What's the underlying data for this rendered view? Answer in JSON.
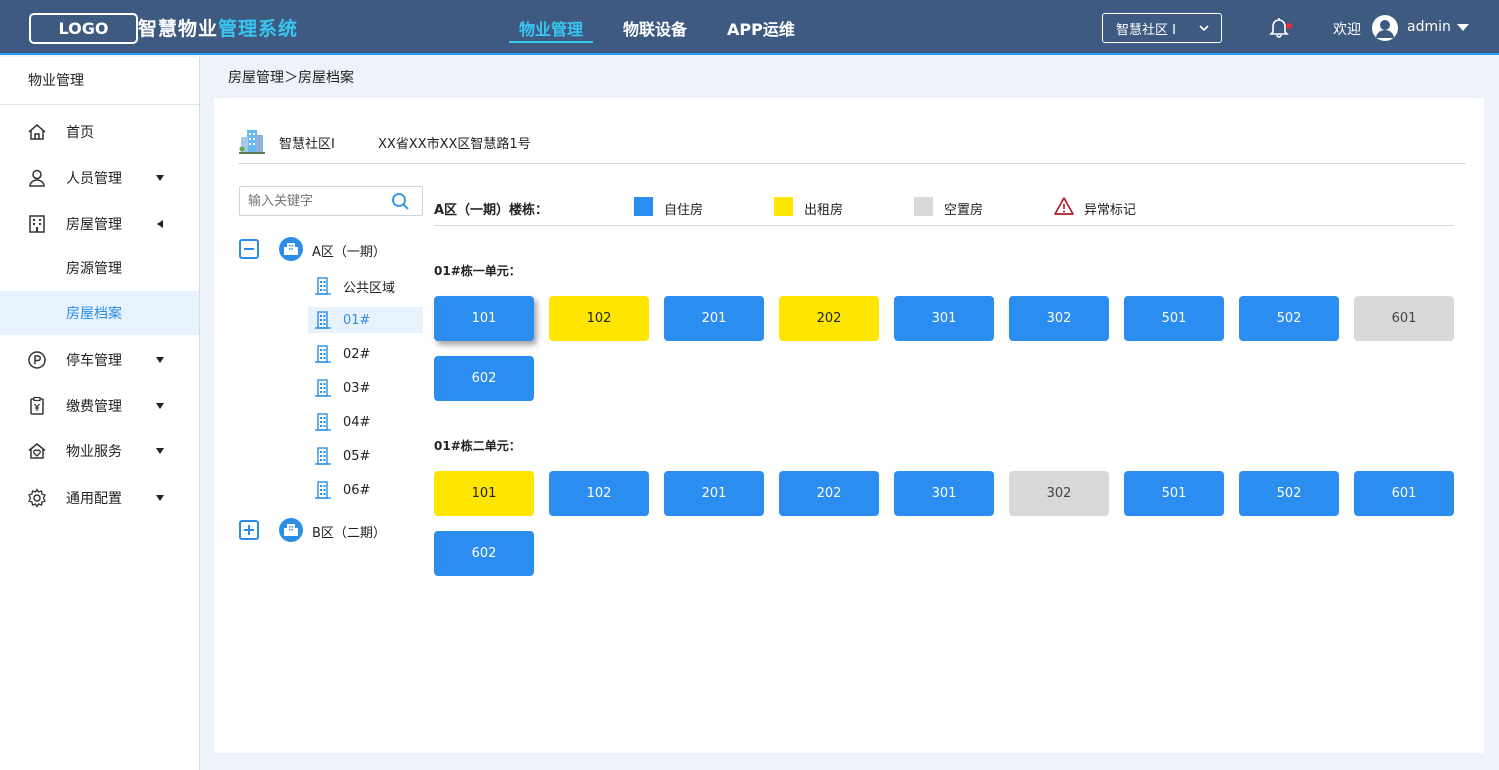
{
  "header": {
    "logo": "LOGO",
    "title_part1": "智慧物业",
    "title_part2": "管理系统",
    "nav": [
      "物业管理",
      "物联设备",
      "APP运维"
    ],
    "community_select": "智慧社区 I",
    "welcome": "欢迎",
    "username": "admin"
  },
  "sidebar": {
    "heading": "物业管理",
    "items": [
      {
        "label": "首页",
        "icon": "home-icon"
      },
      {
        "label": "人员管理",
        "icon": "user-icon"
      },
      {
        "label": "房屋管理",
        "icon": "building-icon"
      },
      {
        "label": "房源管理",
        "icon": ""
      },
      {
        "label": "房屋档案",
        "icon": ""
      },
      {
        "label": "停车管理",
        "icon": "parking-icon"
      },
      {
        "label": "缴费管理",
        "icon": "payment-icon"
      },
      {
        "label": "物业服务",
        "icon": "service-icon"
      },
      {
        "label": "通用配置",
        "icon": "gear-icon"
      }
    ]
  },
  "breadcrumb": "房屋管理＞房屋档案",
  "community": {
    "name": "智慧社区I",
    "address": "XX省XX市XX区智慧路1号"
  },
  "search": {
    "placeholder": "输入关键字"
  },
  "tree": {
    "zone_a": "A区（一期）",
    "zone_b": "B区（二期）",
    "children": [
      "公共区域",
      "01#",
      "02#",
      "03#",
      "04#",
      "05#",
      "06#"
    ]
  },
  "legend": {
    "title": "A区（一期）楼栋：",
    "self": "自住房",
    "rent": "出租房",
    "empty": "空置房",
    "abnormal": "异常标记"
  },
  "colors": {
    "self": "#2b8df0",
    "rent": "#ffe600",
    "empty": "#d9d9d9",
    "accent": "#39c6f0"
  },
  "units": [
    {
      "title": "01#栋一单元：",
      "rooms": [
        {
          "no": "101",
          "type": "self"
        },
        {
          "no": "102",
          "type": "rent"
        },
        {
          "no": "201",
          "type": "self"
        },
        {
          "no": "202",
          "type": "rent"
        },
        {
          "no": "301",
          "type": "self"
        },
        {
          "no": "302",
          "type": "self"
        },
        {
          "no": "501",
          "type": "self"
        },
        {
          "no": "502",
          "type": "self"
        },
        {
          "no": "601",
          "type": "empty"
        },
        {
          "no": "602",
          "type": "self"
        }
      ]
    },
    {
      "title": "01#栋二单元：",
      "rooms": [
        {
          "no": "101",
          "type": "rent"
        },
        {
          "no": "102",
          "type": "self"
        },
        {
          "no": "201",
          "type": "self"
        },
        {
          "no": "202",
          "type": "self"
        },
        {
          "no": "301",
          "type": "self"
        },
        {
          "no": "302",
          "type": "empty"
        },
        {
          "no": "501",
          "type": "self"
        },
        {
          "no": "502",
          "type": "self"
        },
        {
          "no": "601",
          "type": "self"
        },
        {
          "no": "602",
          "type": "self"
        }
      ]
    }
  ]
}
